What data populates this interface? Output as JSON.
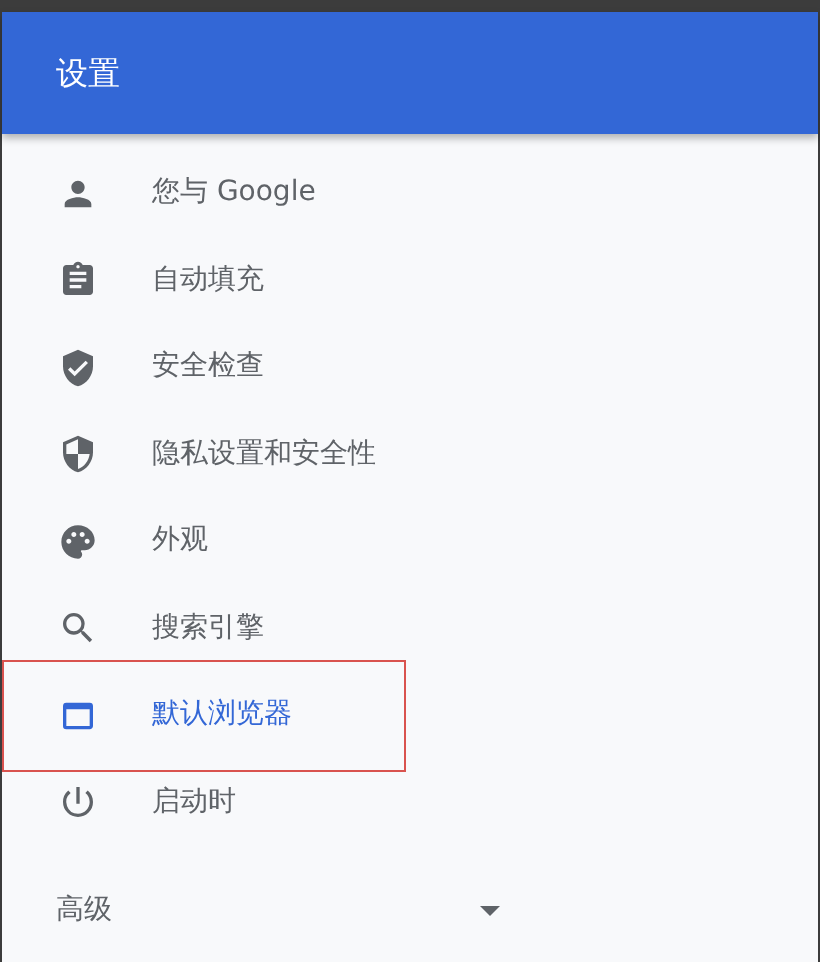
{
  "header": {
    "title": "设置"
  },
  "menu": [
    {
      "label": "您与 Google",
      "selected": false,
      "highlighted": false
    },
    {
      "label": "自动填充",
      "selected": false,
      "highlighted": false
    },
    {
      "label": "安全检查",
      "selected": false,
      "highlighted": false
    },
    {
      "label": "隐私设置和安全性",
      "selected": false,
      "highlighted": false
    },
    {
      "label": "外观",
      "selected": false,
      "highlighted": false
    },
    {
      "label": "搜索引擎",
      "selected": false,
      "highlighted": false
    },
    {
      "label": "默认浏览器",
      "selected": true,
      "highlighted": true
    },
    {
      "label": "启动时",
      "selected": false,
      "highlighted": false
    }
  ],
  "advanced": {
    "label": "高级",
    "expanded": false
  }
}
